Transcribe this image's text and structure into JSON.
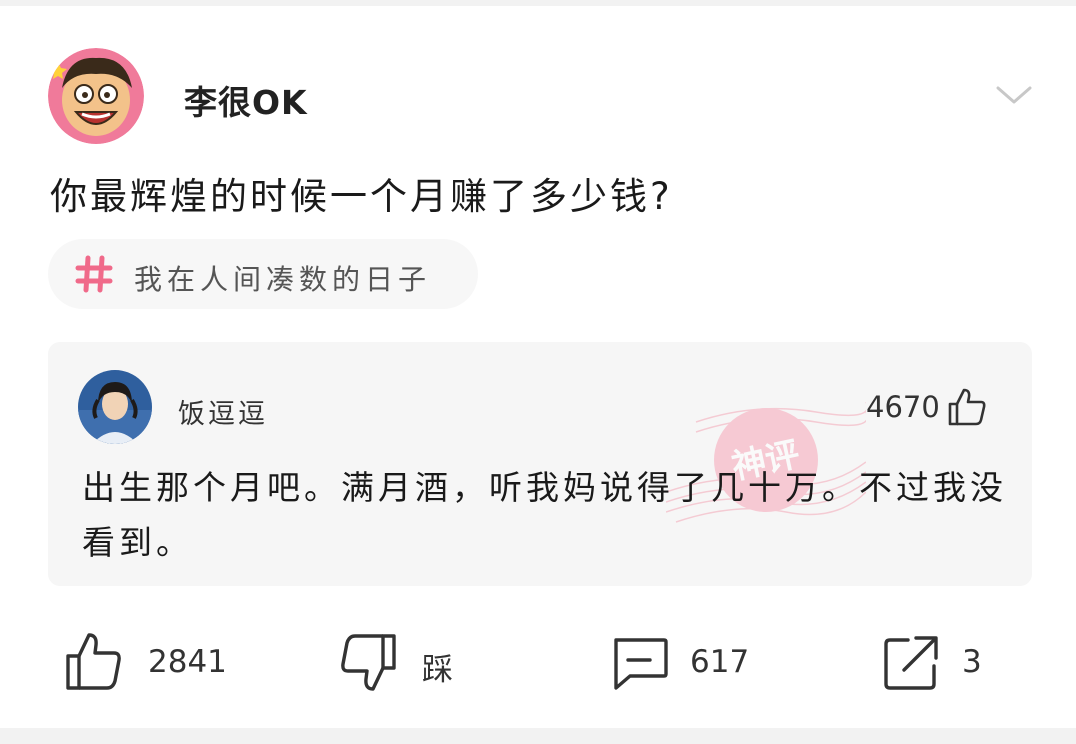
{
  "post": {
    "author_name": "李很OK",
    "title": "你最辉煌的时候一个月赚了多少钱?",
    "topic": "我在人间凑数的日子"
  },
  "comment": {
    "author_name": "饭逗逗",
    "likes": "4670",
    "text": "出生那个月吧。满月酒，听我妈说得了几十万。不过我没看到。",
    "stamp_text": "神评"
  },
  "actions": {
    "like_count": "2841",
    "dislike_label": "踩",
    "comment_count": "617",
    "share_count": "3"
  },
  "colors": {
    "accent_pink": "#f06a8a",
    "comment_bg": "#f6f6f6",
    "icon": "#333333"
  }
}
